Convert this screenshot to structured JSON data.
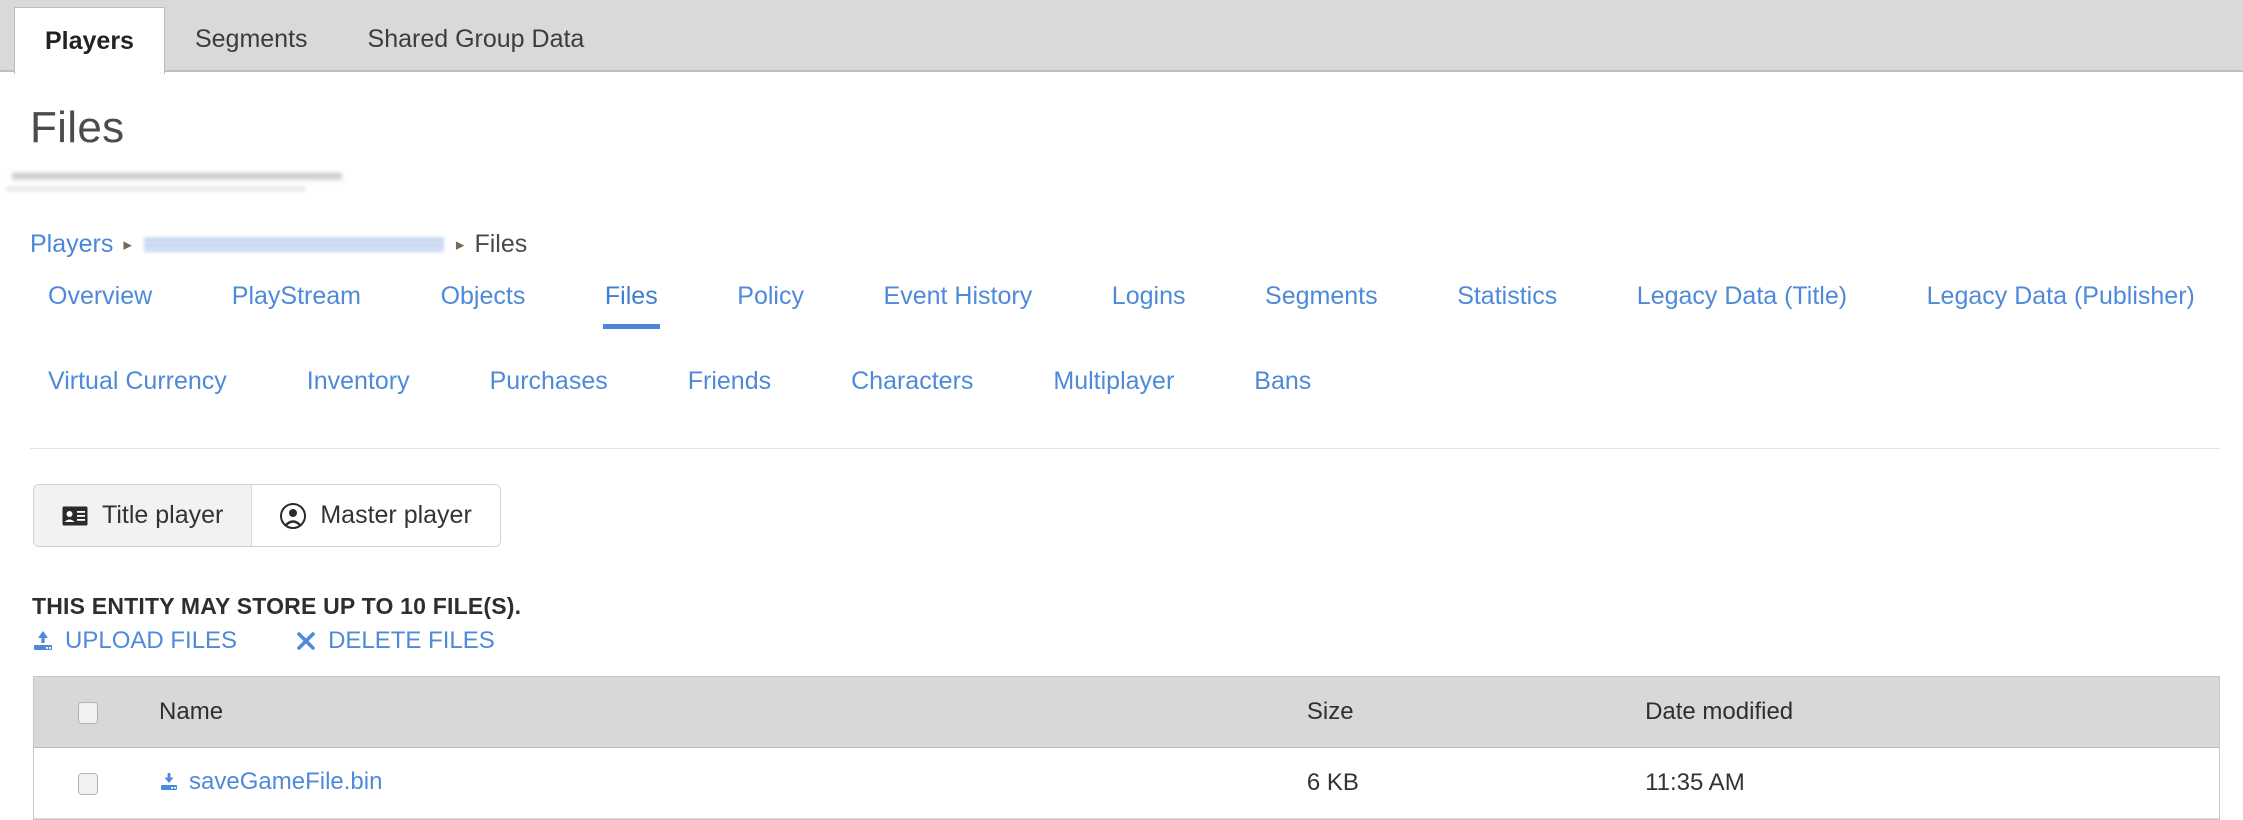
{
  "top_tabs": [
    {
      "label": "Players",
      "active": true
    },
    {
      "label": "Segments",
      "active": false
    },
    {
      "label": "Shared Group Data",
      "active": false
    }
  ],
  "page": {
    "title": "Files"
  },
  "breadcrumb": {
    "first": "Players",
    "middle_redacted": "",
    "last": "Files",
    "separator": "▸"
  },
  "subnav": {
    "row1": [
      {
        "label": "Overview",
        "active": false
      },
      {
        "label": "PlayStream",
        "active": false
      },
      {
        "label": "Objects",
        "active": false
      },
      {
        "label": "Files",
        "active": true
      },
      {
        "label": "Policy",
        "active": false
      },
      {
        "label": "Event History",
        "active": false
      },
      {
        "label": "Logins",
        "active": false
      },
      {
        "label": "Segments",
        "active": false
      },
      {
        "label": "Statistics",
        "active": false
      },
      {
        "label": "Legacy Data (Title)",
        "active": false
      },
      {
        "label": "Legacy Data (Publisher)",
        "active": false
      }
    ],
    "row2": [
      {
        "label": "Virtual Currency",
        "active": false
      },
      {
        "label": "Inventory",
        "active": false
      },
      {
        "label": "Purchases",
        "active": false
      },
      {
        "label": "Friends",
        "active": false
      },
      {
        "label": "Characters",
        "active": false
      },
      {
        "label": "Multiplayer",
        "active": false
      },
      {
        "label": "Bans",
        "active": false
      }
    ]
  },
  "player_toggle": {
    "title_player": {
      "label": "Title player",
      "icon": "id-card-icon",
      "selected": true
    },
    "master_player": {
      "label": "Master player",
      "icon": "user-circle-icon",
      "selected": false
    }
  },
  "files_section": {
    "entity_note": "THIS ENTITY MAY STORE UP TO 10 FILE(S).",
    "upload_label": "UPLOAD FILES",
    "upload_icon": "upload-icon",
    "delete_label": "DELETE FILES",
    "delete_icon": "close-x-icon",
    "columns": [
      "",
      "Name",
      "Size",
      "Date modified"
    ],
    "rows": [
      {
        "name": "saveGameFile.bin",
        "size": "6 KB",
        "date_modified": "11:35 AM",
        "icon": "download-icon",
        "checked": false
      }
    ]
  },
  "colors": {
    "link_blue": "#4e8ad9",
    "accent_underline": "#4a87d8",
    "tabstrip_grey": "#d9d9d9",
    "table_header_grey": "#d8d8d8",
    "text_dark": "#333333"
  }
}
